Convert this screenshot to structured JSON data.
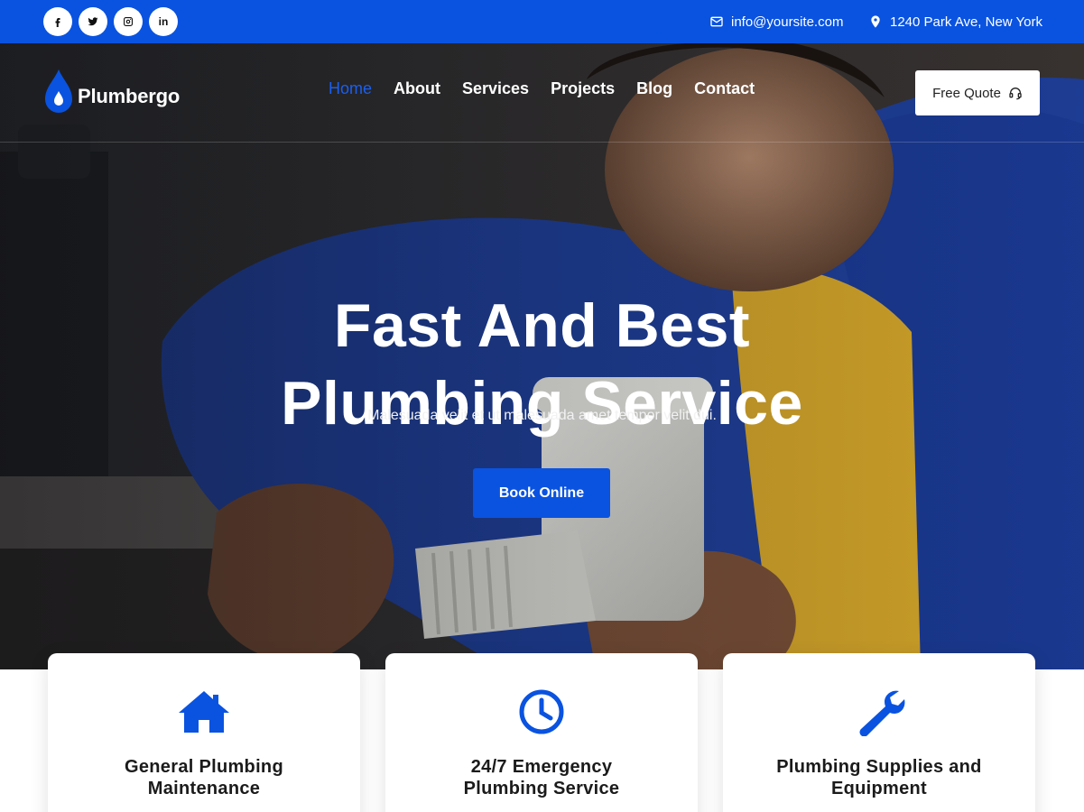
{
  "topbar": {
    "socials": [
      {
        "icon": "facebook-icon",
        "glyph": "f"
      },
      {
        "icon": "twitter-icon",
        "glyph": ""
      },
      {
        "icon": "instagram-icon",
        "glyph": ""
      },
      {
        "icon": "linkedin-icon",
        "glyph": "in"
      }
    ],
    "email": "info@yoursite.com",
    "address": "1240 Park Ave, New York"
  },
  "brand": {
    "name": "Plumbergo",
    "icon": "water-drop-icon"
  },
  "nav": {
    "items": [
      {
        "label": "Home",
        "active": true
      },
      {
        "label": "About",
        "active": false
      },
      {
        "label": "Services",
        "active": false
      },
      {
        "label": "Projects",
        "active": false
      },
      {
        "label": "Blog",
        "active": false
      },
      {
        "label": "Contact",
        "active": false
      }
    ],
    "quote_label": "Free Quote",
    "quote_icon": "headset-icon"
  },
  "hero": {
    "title_line1": "Fast And Best",
    "title_line2": "Plumbing Service",
    "subtitle": "Malesuada velit et ut malesuada amet tempor velit dui.",
    "cta_label": "Book Online"
  },
  "features": [
    {
      "icon": "house-icon",
      "title_line1": "General Plumbing",
      "title_line2": "Maintenance"
    },
    {
      "icon": "clock-icon",
      "title_line1": "24/7 Emergency",
      "title_line2": "Plumbing Service"
    },
    {
      "icon": "wrench-icon",
      "title_line1": "Plumbing Supplies and",
      "title_line2": "Equipment"
    }
  ],
  "colors": {
    "primary": "#0a53e0",
    "nav_active": "#1a5ff0",
    "text_dark": "#1b1b1b",
    "white": "#ffffff"
  }
}
